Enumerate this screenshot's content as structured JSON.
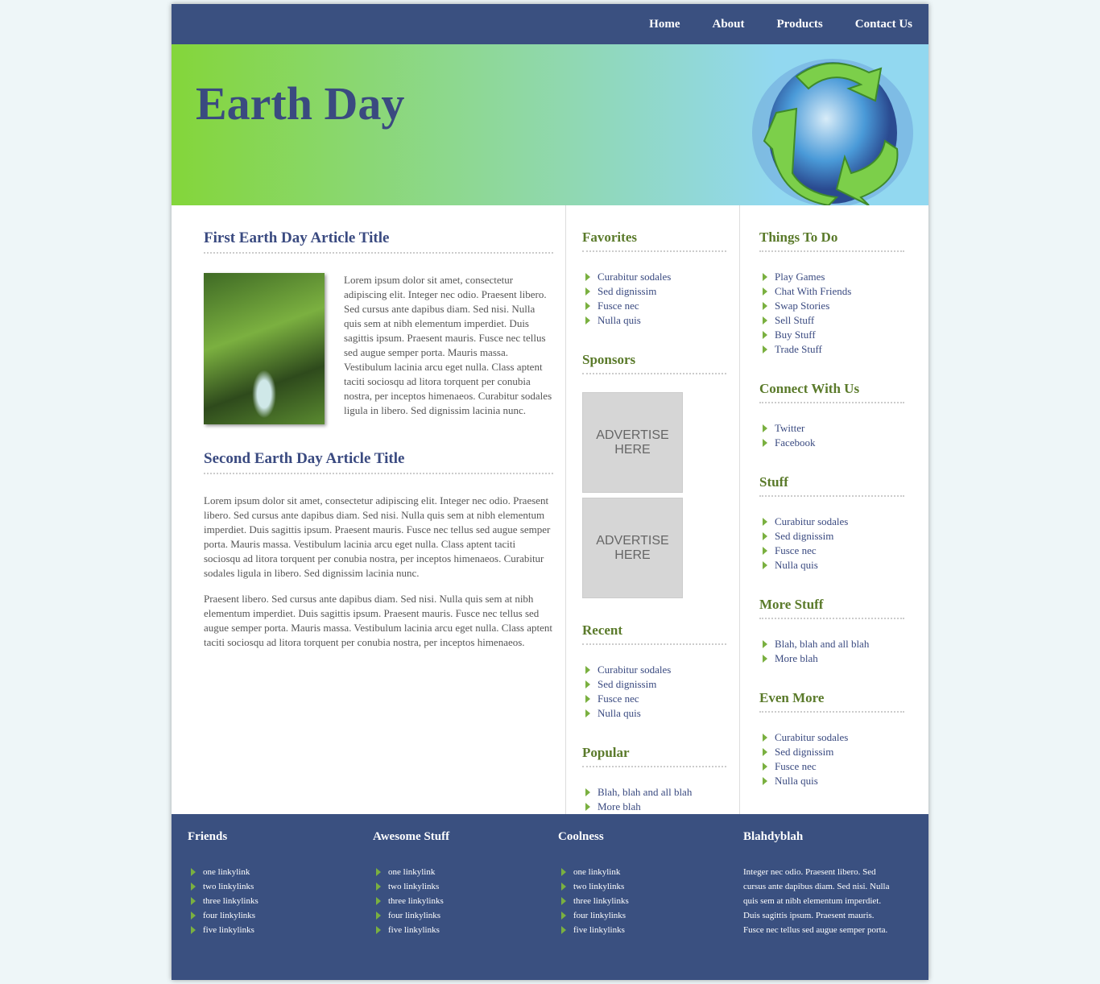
{
  "nav": [
    "Home",
    "About",
    "Products",
    "Contact Us"
  ],
  "hero": {
    "title": "Earth Day",
    "logo": "recycle-globe-icon"
  },
  "articles": [
    {
      "title": "First Earth Day Article Title",
      "paragraphs": [
        "Lorem ipsum dolor sit amet, consectetur adipiscing elit. Integer nec odio. Praesent libero. Sed cursus ante dapibus diam. Sed nisi. Nulla quis sem at nibh elementum imperdiet. Duis sagittis ipsum. Praesent mauris. Fusce nec tellus sed augue semper porta. Mauris massa. Vestibulum lacinia arcu eget nulla. Class aptent taciti sociosqu ad litora torquent per conubia nostra, per inceptos himenaeos. Curabitur sodales ligula in libero. Sed dignissim lacinia nunc."
      ]
    },
    {
      "title": "Second Earth Day Article Title",
      "paragraphs": [
        "Lorem ipsum dolor sit amet, consectetur adipiscing elit. Integer nec odio. Praesent libero. Sed cursus ante dapibus diam. Sed nisi. Nulla quis sem at nibh elementum imperdiet. Duis sagittis ipsum. Praesent mauris. Fusce nec tellus sed augue semper porta. Mauris massa. Vestibulum lacinia arcu eget nulla. Class aptent taciti sociosqu ad litora torquent per conubia nostra, per inceptos himenaeos. Curabitur sodales ligula in libero. Sed dignissim lacinia nunc.",
        "Praesent libero. Sed cursus ante dapibus diam. Sed nisi. Nulla quis sem at nibh elementum imperdiet. Duis sagittis ipsum. Praesent mauris. Fusce nec tellus sed augue semper porta. Mauris massa. Vestibulum lacinia arcu eget nulla. Class aptent taciti sociosqu ad litora torquent per conubia nostra, per inceptos himenaeos."
      ]
    }
  ],
  "mid": {
    "favorites": {
      "title": "Favorites",
      "items": [
        "Curabitur sodales",
        "Sed dignissim",
        "Fusce nec",
        "Nulla quis"
      ]
    },
    "sponsors": {
      "title": "Sponsors",
      "ads": [
        "ADVERTISE HERE",
        "ADVERTISE HERE"
      ]
    },
    "recent": {
      "title": "Recent",
      "items": [
        "Curabitur sodales",
        "Sed dignissim",
        "Fusce nec",
        "Nulla quis"
      ]
    },
    "popular": {
      "title": "Popular",
      "items": [
        "Blah, blah and all blah",
        "More blah"
      ]
    }
  },
  "right": [
    {
      "title": "Things To Do",
      "items": [
        "Play Games",
        "Chat With Friends",
        "Swap Stories",
        "Sell Stuff",
        "Buy Stuff",
        "Trade Stuff"
      ]
    },
    {
      "title": "Connect With Us",
      "items": [
        "Twitter",
        "Facebook"
      ]
    },
    {
      "title": "Stuff",
      "items": [
        "Curabitur sodales",
        "Sed dignissim",
        "Fusce nec",
        "Nulla quis"
      ]
    },
    {
      "title": "More Stuff",
      "items": [
        "Blah, blah and all blah",
        "More blah"
      ]
    },
    {
      "title": "Even More",
      "items": [
        "Curabitur sodales",
        "Sed dignissim",
        "Fusce nec",
        "Nulla quis"
      ]
    }
  ],
  "footer": [
    {
      "title": "Friends",
      "items": [
        "one linkylink",
        "two linkylinks",
        "three linkylinks",
        "four linkylinks",
        "five linkylinks"
      ]
    },
    {
      "title": "Awesome Stuff",
      "items": [
        "one linkylink",
        "two linkylinks",
        "three linkylinks",
        "four linkylinks",
        "five linkylinks"
      ]
    },
    {
      "title": "Coolness",
      "items": [
        "one linkylink",
        "two linkylinks",
        "three linkylinks",
        "four linkylinks",
        "five linkylinks"
      ]
    },
    {
      "title": "Blahdyblah",
      "text": "Integer nec odio. Praesent libero. Sed cursus ante dapibus diam. Sed nisi. Nulla quis sem at nibh elementum imperdiet. Duis sagittis ipsum. Praesent mauris. Fusce nec tellus sed augue semper porta."
    }
  ],
  "colors": {
    "nav": "#3a5080",
    "heading": "#3a4a80",
    "side_heading": "#5a7a2a",
    "bullet": "#7ab040"
  }
}
